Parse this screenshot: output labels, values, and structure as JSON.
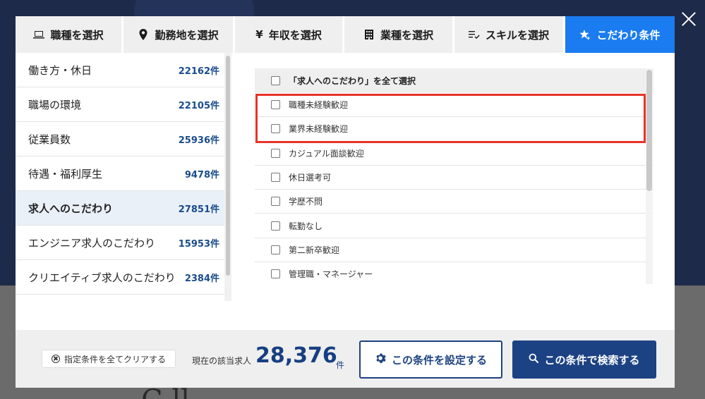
{
  "tabs": [
    {
      "label": "職種を選択",
      "icon": "monitor-icon"
    },
    {
      "label": "勤務地を選択",
      "icon": "location-pin-icon"
    },
    {
      "label": "年収を選択",
      "icon": "yen-icon"
    },
    {
      "label": "業種を選択",
      "icon": "building-icon"
    },
    {
      "label": "スキルを選択",
      "icon": "list-check-icon"
    },
    {
      "label": "こだわり条件",
      "icon": "star-plus-icon"
    }
  ],
  "categories": [
    {
      "label": "働き方・休日",
      "count": "22162件"
    },
    {
      "label": "職場の環境",
      "count": "22105件"
    },
    {
      "label": "従業員数",
      "count": "25936件"
    },
    {
      "label": "待遇・福利厚生",
      "count": "9478件"
    },
    {
      "label": "求人へのこだわり",
      "count": "27851件"
    },
    {
      "label": "エンジニア求人のこだわり",
      "count": "15953件"
    },
    {
      "label": "クリエイティブ求人のこだわり",
      "count": "2384件"
    }
  ],
  "options": {
    "select_all": "「求人へのこだわり」を全て選択",
    "items": [
      "職種未経験歓迎",
      "業界未経験歓迎",
      "カジュアル面談歓迎",
      "休日選考可",
      "学歴不問",
      "転勤なし",
      "第二新卒歓迎",
      "管理職・マネージャー"
    ]
  },
  "footer": {
    "clear_label": "指定条件を全てクリアする",
    "count_label": "現在の該当求人",
    "count_value": "28,376",
    "count_unit": "件",
    "set_label": "この条件を設定する",
    "search_label": "この条件で検索する"
  },
  "colors": {
    "accent": "#1a7cf0",
    "navy": "#1d4283",
    "highlight": "#e8332a"
  }
}
